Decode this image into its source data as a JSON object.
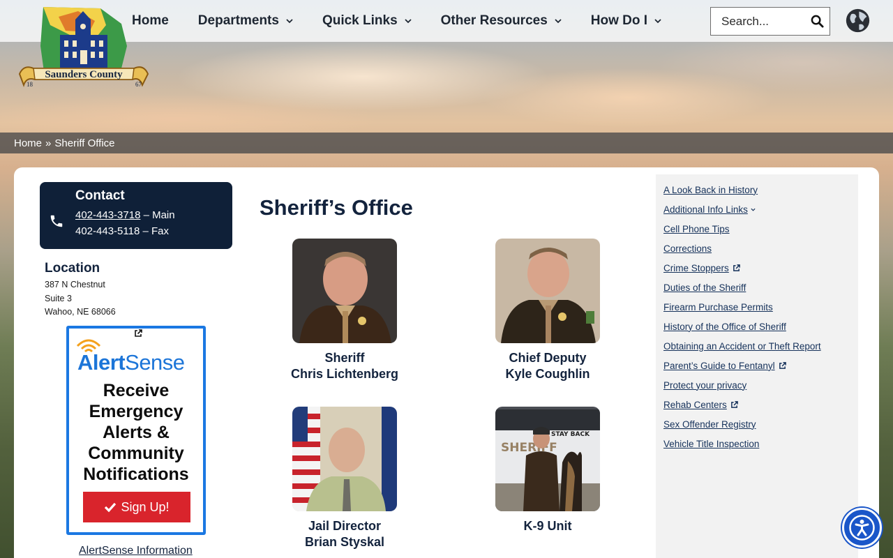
{
  "header": {
    "logo": {
      "name": "Saunders County",
      "year_left": "18",
      "year_right": "67"
    },
    "nav": [
      {
        "label": "Home",
        "has_dropdown": false
      },
      {
        "label": "Departments",
        "has_dropdown": true
      },
      {
        "label": "Quick Links",
        "has_dropdown": true
      },
      {
        "label": "Other Resources",
        "has_dropdown": true
      },
      {
        "label": "How Do I",
        "has_dropdown": true
      }
    ],
    "search": {
      "placeholder": "Search...",
      "value": ""
    },
    "icons": {
      "search": "search-icon",
      "language": "globe-icon"
    }
  },
  "breadcrumb": {
    "home": "Home",
    "separator": "»",
    "current": "Sheriff Office"
  },
  "contact": {
    "title": "Contact",
    "main_phone": "402-443-3718",
    "main_suffix": " – Main",
    "fax_line": "402-443-5118 – Fax"
  },
  "location": {
    "title": "Location",
    "line1": "387 N Chestnut",
    "line2": "Suite 3",
    "line3": "Wahoo, NE 68066"
  },
  "alert_card": {
    "logo_bold": "Alert",
    "logo_light": "Sense",
    "headline_1": "Receive",
    "headline_2": "Emergency",
    "headline_3": "Alerts &",
    "headline_4": "Community",
    "headline_5": "Notifications",
    "button_label": "Sign Up!",
    "info_link": "AlertSense Information"
  },
  "page_title": "Sheriff’s Office",
  "staff": [
    {
      "role": "Sheriff",
      "name": "Chris Lichtenberg"
    },
    {
      "role": "Chief Deputy",
      "name": "Kyle Coughlin"
    },
    {
      "role": "Jail Director",
      "name": "Brian Styskal"
    },
    {
      "role": "K-9 Unit",
      "name": ""
    }
  ],
  "k9_photo_text": {
    "sign": "STAY BACK",
    "car": "SHERIFF"
  },
  "sidebar_links": [
    {
      "label": "A Look Back in History",
      "external": false,
      "dropdown": false
    },
    {
      "label": "Additional Info Links",
      "external": false,
      "dropdown": true
    },
    {
      "label": "Cell Phone Tips",
      "external": false,
      "dropdown": false
    },
    {
      "label": "Corrections",
      "external": false,
      "dropdown": false
    },
    {
      "label": "Crime Stoppers",
      "external": true,
      "dropdown": false
    },
    {
      "label": "Duties of the Sheriff",
      "external": false,
      "dropdown": false
    },
    {
      "label": "Firearm Purchase Permits",
      "external": false,
      "dropdown": false
    },
    {
      "label": "History of the Office of Sheriff",
      "external": false,
      "dropdown": false
    },
    {
      "label": "Obtaining an Accident or Theft Report",
      "external": false,
      "dropdown": false
    },
    {
      "label": "Parent’s Guide to Fentanyl",
      "external": true,
      "dropdown": false
    },
    {
      "label": "Protect your privacy",
      "external": false,
      "dropdown": false
    },
    {
      "label": "Rehab Centers",
      "external": true,
      "dropdown": false
    },
    {
      "label": "Sex Offender Registry",
      "external": false,
      "dropdown": false
    },
    {
      "label": "Vehicle Title Inspection",
      "external": false,
      "dropdown": false
    }
  ],
  "colors": {
    "navy": "#13233d",
    "contact_bg": "#0f2038",
    "alert_blue": "#1b78e2",
    "signup_red": "#d9242c",
    "a11y_blue": "#1a56c9"
  }
}
